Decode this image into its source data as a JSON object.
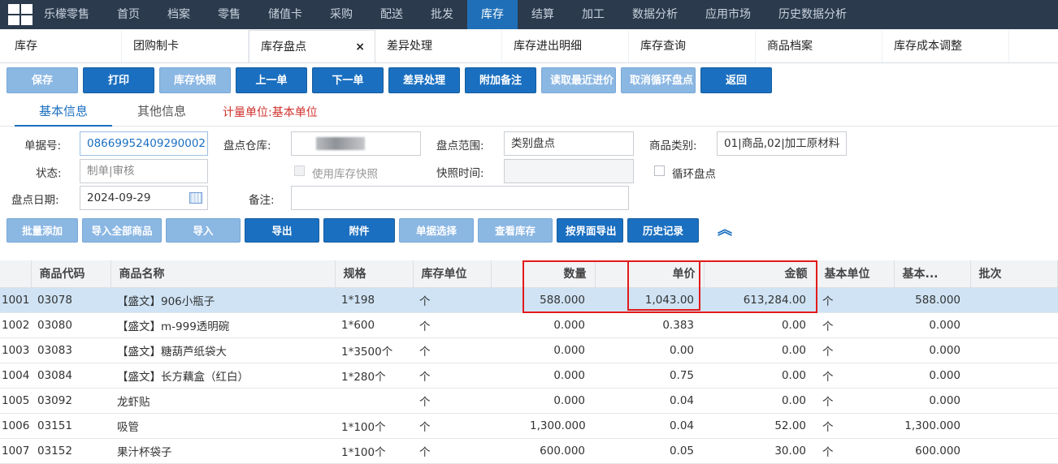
{
  "nav": {
    "brand": "乐檬零售",
    "items": [
      "首页",
      "档案",
      "零售",
      "储值卡",
      "采购",
      "配送",
      "批发",
      "库存",
      "结算",
      "加工",
      "数据分析",
      "应用市场",
      "历史数据分析"
    ],
    "active_index": 7
  },
  "tabs": [
    {
      "label": "库存"
    },
    {
      "label": "团购制卡"
    },
    {
      "label": "库存盘点",
      "close": "×"
    },
    {
      "label": "差异处理"
    },
    {
      "label": "库存进出明细"
    },
    {
      "label": "库存查询"
    },
    {
      "label": "商品档案"
    },
    {
      "label": "库存成本调整"
    }
  ],
  "toolbar": {
    "save": "保存",
    "print": "打印",
    "snapshot": "库存快照",
    "prev": "上一单",
    "next": "下一单",
    "diff": "差异处理",
    "note": "附加备注",
    "latest_price": "读取最近进价",
    "cancel_cycle": "取消循环盘点",
    "back": "返回"
  },
  "subtabs": {
    "basic": "基本信息",
    "other": "其他信息",
    "unit_note": "计量单位:基本单位"
  },
  "form": {
    "order_no_label": "单据号:",
    "order_no": "08669952409290002",
    "warehouse_label": "盘点仓库:",
    "range_label": "盘点范围:",
    "range": "类别盘点",
    "category_label": "商品类别:",
    "category": "01|商品,02|加工原材料",
    "status_label": "状态:",
    "status": "制单|审核",
    "use_snapshot": "使用库存快照",
    "snapshot_time_label": "快照时间:",
    "cycle_label": "循环盘点",
    "date_label": "盘点日期:",
    "date": "2024-09-29",
    "remark_label": "备注:"
  },
  "toolbar2": {
    "batch_add": "批量添加",
    "import_all": "导入全部商品",
    "import": "导入",
    "export": "导出",
    "attach": "附件",
    "doc_select": "单据选择",
    "view_stock": "查看库存",
    "export_ui": "按界面导出",
    "history": "历史记录",
    "collapse_icon": "double-chevron-up-icon"
  },
  "table": {
    "columns": [
      "",
      "商品代码",
      "商品名称",
      "规格",
      "库存单位",
      "",
      "数量",
      "单价",
      "金额",
      "基本单位",
      "基本...",
      "批次"
    ],
    "rows": [
      [
        "1001",
        "03078",
        "【盛文】906小瓶子",
        "1*198",
        "个",
        "588.000",
        "1,043.00",
        "613,284.00",
        "个",
        "588.000"
      ],
      [
        "1002",
        "03080",
        "【盛文】m-999透明碗",
        "1*600",
        "个",
        "0.000",
        "0.383",
        "0.00",
        "个",
        "0.000"
      ],
      [
        "1003",
        "03083",
        "【盛文】糖葫芦纸袋大",
        "1*3500个",
        "个",
        "0.000",
        "0.00",
        "0.00",
        "个",
        "0.000"
      ],
      [
        "1004",
        "03084",
        "【盛文】长方藕盒（红白）",
        "1*280个",
        "个",
        "0.000",
        "0.75",
        "0.00",
        "个",
        "0.000"
      ],
      [
        "1005",
        "03092",
        "龙虾贴",
        "",
        "个",
        "0.000",
        "0.04",
        "0.00",
        "个",
        "0.000"
      ],
      [
        "1006",
        "03151",
        "吸管",
        "1*100个",
        "个",
        "1,300.000",
        "0.04",
        "52.00",
        "个",
        "1,300.000"
      ],
      [
        "1007",
        "03152",
        "果汁杯袋子",
        "1*100个",
        "个",
        "600.000",
        "0.05",
        "30.00",
        "个",
        "600.000"
      ]
    ]
  }
}
